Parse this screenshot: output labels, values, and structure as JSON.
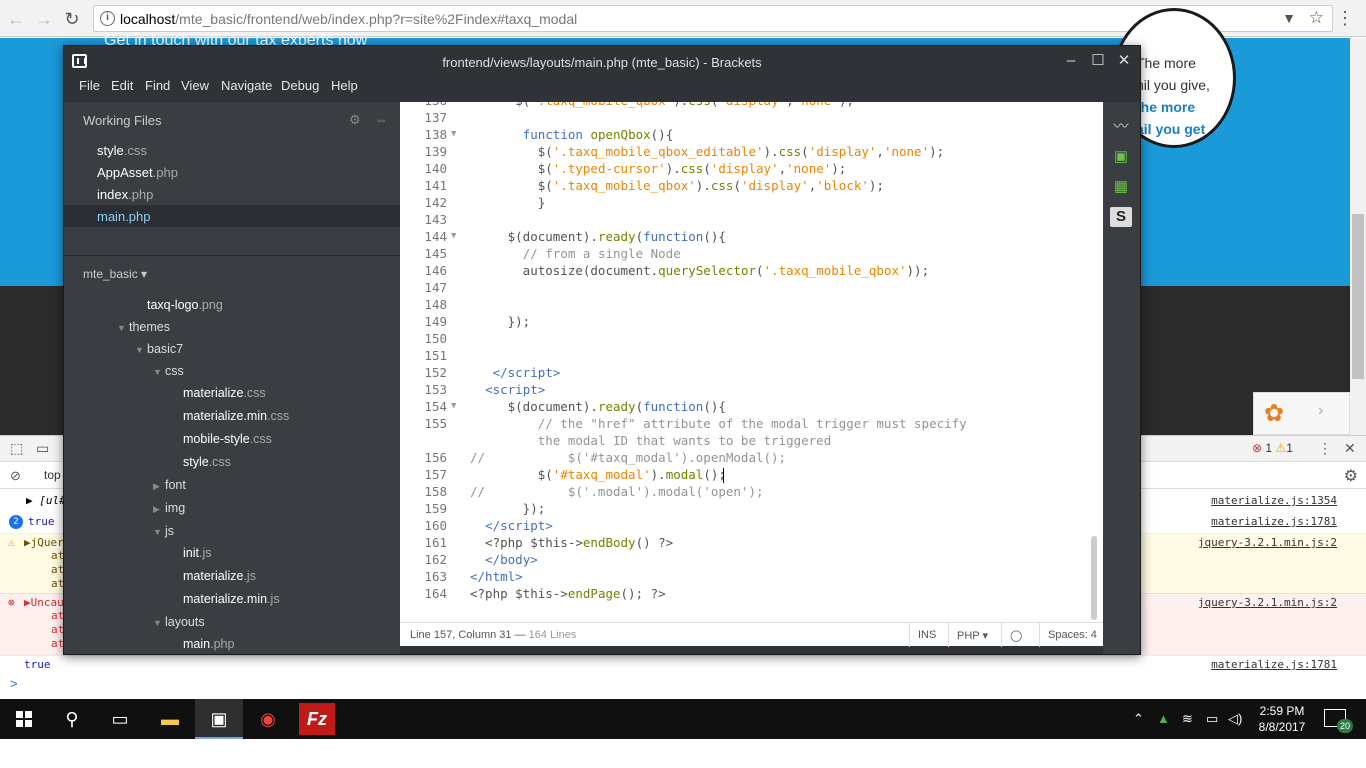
{
  "browser": {
    "url_host": "localhost",
    "url_path": "/mte_basic/frontend/web/index.php?r=site%2Findex#taxq_modal"
  },
  "webpage": {
    "headline": "Get in touch with our tax experts now",
    "bubble_lines": [
      "The more",
      "nil you give,",
      "the more",
      "ail you get"
    ]
  },
  "devtools": {
    "context": "top",
    "error_count": "1",
    "warning_count": "1",
    "lines": [
      {
        "kind": "log",
        "text": "▶ [ul#",
        "source": "materialize.js:1354"
      },
      {
        "kind": "count",
        "count": "2",
        "text": "true",
        "source": "materialize.js:1781"
      },
      {
        "kind": "warn",
        "text": "▶jQuer",
        "stack": [
          "at",
          "at",
          "at"
        ],
        "source": "jquery-3.2.1.min.js:2"
      },
      {
        "kind": "err",
        "text": "▶Uncau",
        "stack": [
          "at",
          "at",
          "at"
        ],
        "source": "jquery-3.2.1.min.js:2"
      },
      {
        "kind": "log",
        "text": "true",
        "source": "materialize.js:1781"
      }
    ],
    "prompt": ">"
  },
  "brackets": {
    "title": "frontend/views/layouts/main.php (mte_basic) - Brackets",
    "menu": [
      "File",
      "Edit",
      "Find",
      "View",
      "Navigate",
      "Debug",
      "Help"
    ],
    "working_files_title": "Working Files",
    "working_files": [
      {
        "name": "style",
        "ext": ".css"
      },
      {
        "name": "AppAsset",
        "ext": ".php"
      },
      {
        "name": "index",
        "ext": ".php"
      },
      {
        "name": "main",
        "ext": ".php"
      }
    ],
    "project": "mte_basic ▾",
    "tree": [
      {
        "name": "taxq-logo",
        "ext": ".png"
      },
      {
        "name": "themes",
        "ext": ""
      },
      {
        "name": "basic7",
        "ext": ""
      },
      {
        "name": "css",
        "ext": ""
      },
      {
        "name": "materialize",
        "ext": ".css"
      },
      {
        "name": "materialize.min",
        "ext": ".css"
      },
      {
        "name": "mobile-style",
        "ext": ".css"
      },
      {
        "name": "style",
        "ext": ".css"
      },
      {
        "name": "font",
        "ext": ""
      },
      {
        "name": "img",
        "ext": ""
      },
      {
        "name": "js",
        "ext": ""
      },
      {
        "name": "init",
        "ext": ".js"
      },
      {
        "name": "materialize",
        "ext": ".js"
      },
      {
        "name": "materialize.min",
        "ext": ".js"
      },
      {
        "name": "layouts",
        "ext": ""
      },
      {
        "name": "main",
        "ext": ".php"
      }
    ],
    "code": [
      {
        "n": "136",
        "html": "      $(<span class='s'>'.taxq_mobile_qbox'</span>).<span class='f'>css</span>(<span class='s'>'display'</span>,<span class='s'>'none'</span>);"
      },
      {
        "n": "137",
        "html": ""
      },
      {
        "n": "138",
        "fold": true,
        "html": "       <span class='k'>function</span> <span class='f'>openQbox</span>(){"
      },
      {
        "n": "139",
        "html": "         $(<span class='s'>'.taxq_mobile_qbox_editable'</span>).<span class='f'>css</span>(<span class='s'>'display'</span>,<span class='s'>'none'</span>);"
      },
      {
        "n": "140",
        "html": "         $(<span class='s'>'.typed-cursor'</span>).<span class='f'>css</span>(<span class='s'>'display'</span>,<span class='s'>'none'</span>);"
      },
      {
        "n": "141",
        "html": "         $(<span class='s'>'.taxq_mobile_qbox'</span>).<span class='f'>css</span>(<span class='s'>'display'</span>,<span class='s'>'block'</span>);"
      },
      {
        "n": "142",
        "html": "         }"
      },
      {
        "n": "143",
        "html": ""
      },
      {
        "n": "144",
        "fold": true,
        "html": "     $(document).<span class='f'>ready</span>(<span class='k'>function</span>(){"
      },
      {
        "n": "145",
        "html": "       <span class='c'>// from a single Node</span>"
      },
      {
        "n": "146",
        "html": "       autosize(document.<span class='f'>querySelector</span>(<span class='s'>'.taxq_mobile_qbox'</span>));"
      },
      {
        "n": "147",
        "html": ""
      },
      {
        "n": "148",
        "html": ""
      },
      {
        "n": "149",
        "html": "     });"
      },
      {
        "n": "150",
        "html": ""
      },
      {
        "n": "151",
        "html": ""
      },
      {
        "n": "152",
        "html": "   <span class='t'>&lt;/script&gt;</span>"
      },
      {
        "n": "153",
        "html": "  <span class='t'>&lt;script&gt;</span>"
      },
      {
        "n": "154",
        "fold": true,
        "html": "     $(document).<span class='f'>ready</span>(<span class='k'>function</span>(){"
      },
      {
        "n": "155",
        "html": "         <span class='c'>// the \"href\" attribute of the modal trigger must specify</span>"
      },
      {
        "n": "",
        "html": "         <span class='c'>the modal ID that wants to be triggered</span>"
      },
      {
        "n": "156",
        "html": "<span class='c'>//           $('#taxq_modal').openModal();</span>"
      },
      {
        "n": "157",
        "html": "         $(<span class='s'>'#taxq_modal'</span>).<span class='f'>modal</span>();"
      },
      {
        "n": "158",
        "html": "<span class='c'>//           $('.modal').modal('open');</span>"
      },
      {
        "n": "159",
        "html": "       });"
      },
      {
        "n": "160",
        "html": "  <span class='t'>&lt;/script&gt;</span>"
      },
      {
        "n": "161",
        "html": "  &lt;?php $this-&gt;<span class='f'>endBody</span>() ?&gt;"
      },
      {
        "n": "162",
        "html": "  <span class='t'>&lt;/body&gt;</span>"
      },
      {
        "n": "163",
        "html": "<span class='t'>&lt;/html&gt;</span>"
      },
      {
        "n": "164",
        "html": "&lt;?php $this-&gt;<span class='f'>endPage</span>(); ?&gt;"
      }
    ],
    "status": {
      "position": "Line 157, Column 31",
      "lines": "164 Lines",
      "ins": "INS",
      "lang": "PHP ▾",
      "spaces": "Spaces: 4"
    },
    "colors": {
      "accent": "#8fd0f5",
      "editor_bg": "#ffffff",
      "sidebar_bg": "#3a3d42"
    }
  },
  "taskbar": {
    "time": "2:59 PM",
    "date": "8/8/2017",
    "notifications": "20",
    "apps": [
      "file-explorer-icon",
      "brackets-icon",
      "chrome-icon",
      "filezilla-icon"
    ]
  }
}
